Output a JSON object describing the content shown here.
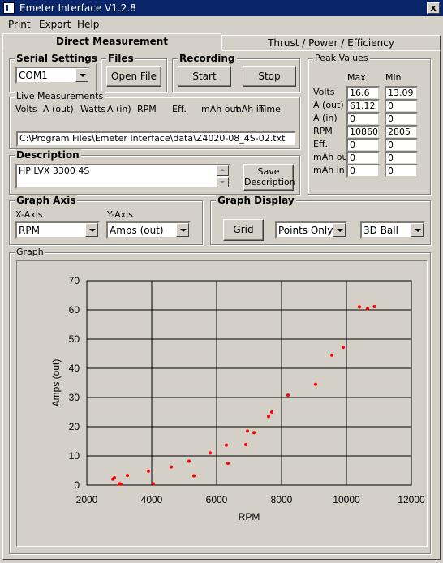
{
  "window": {
    "title": "Emeter Interface V1.2.8",
    "close_symbol": "x"
  },
  "menu": {
    "items": [
      "Print",
      "Export",
      "Help"
    ]
  },
  "tabs": {
    "active": "Direct Measurement",
    "other": "Thrust / Power / Efficiency"
  },
  "serial": {
    "title": "Serial Settings",
    "port": "COM1"
  },
  "files": {
    "title": "Files",
    "open_label": "Open File"
  },
  "recording": {
    "title": "Recording",
    "start_label": "Start",
    "stop_label": "Stop"
  },
  "live": {
    "title": "Live Measurements",
    "columns": [
      "Volts",
      "A (out)",
      "Watts",
      "A (in)",
      "RPM",
      "Eff.",
      "mAh out",
      "mAh in",
      "Time"
    ],
    "path": "C:\\Program Files\\Emeter Interface\\data\\Z4020-08_4S-02.txt"
  },
  "description": {
    "title": "Description",
    "text": "HP LVX 3300 4S",
    "save_label_1": "Save",
    "save_label_2": "Description"
  },
  "peak": {
    "title": "Peak Values",
    "max_header": "Max",
    "min_header": "Min",
    "rows": [
      {
        "label": "Volts",
        "max": "16.6",
        "min": "13.09"
      },
      {
        "label": "A (out)",
        "max": "61.12",
        "min": "0"
      },
      {
        "label": "A (in)",
        "max": "0",
        "min": "0"
      },
      {
        "label": "RPM",
        "max": "10860",
        "min": "2805"
      },
      {
        "label": "Eff.",
        "max": "0",
        "min": "0"
      },
      {
        "label": "mAh out",
        "max": "0",
        "min": "0"
      },
      {
        "label": "mAh in",
        "max": "0",
        "min": "0"
      }
    ]
  },
  "graph_axis": {
    "title": "Graph Axis",
    "x_label": "X-Axis",
    "x_value": "RPM",
    "y_label": "Y-Axis",
    "y_value": "Amps (out)"
  },
  "graph_display": {
    "title": "Graph Display",
    "grid_label": "Grid",
    "mode": "Points Only",
    "marker": "3D Ball"
  },
  "graph": {
    "title": "Graph"
  },
  "chart_data": {
    "type": "scatter",
    "xlabel": "RPM",
    "ylabel": "Amps (out)",
    "xlim": [
      2000,
      12000
    ],
    "ylim": [
      0,
      70
    ],
    "xticks": [
      2000,
      4000,
      6000,
      8000,
      10000,
      12000
    ],
    "yticks": [
      0,
      10,
      20,
      30,
      40,
      50,
      60,
      70
    ],
    "grid": true,
    "point_color": "#ff0000",
    "series": [
      {
        "x": [
          2805,
          2850,
          3000,
          3050,
          3250,
          3900,
          4050,
          4600,
          5150,
          5300,
          5800,
          6300,
          6350,
          6900,
          6950,
          7150,
          7600,
          7700,
          8200,
          9050,
          9550,
          9900,
          10400,
          10650,
          10860
        ],
        "y": [
          2.0,
          2.5,
          0.5,
          0.3,
          3.3,
          4.8,
          0.5,
          6.2,
          8.2,
          3.2,
          11.0,
          13.7,
          7.5,
          13.9,
          18.5,
          18.0,
          23.5,
          25.0,
          30.8,
          34.5,
          44.5,
          47.2,
          61.0,
          60.4,
          61.12
        ]
      }
    ]
  }
}
